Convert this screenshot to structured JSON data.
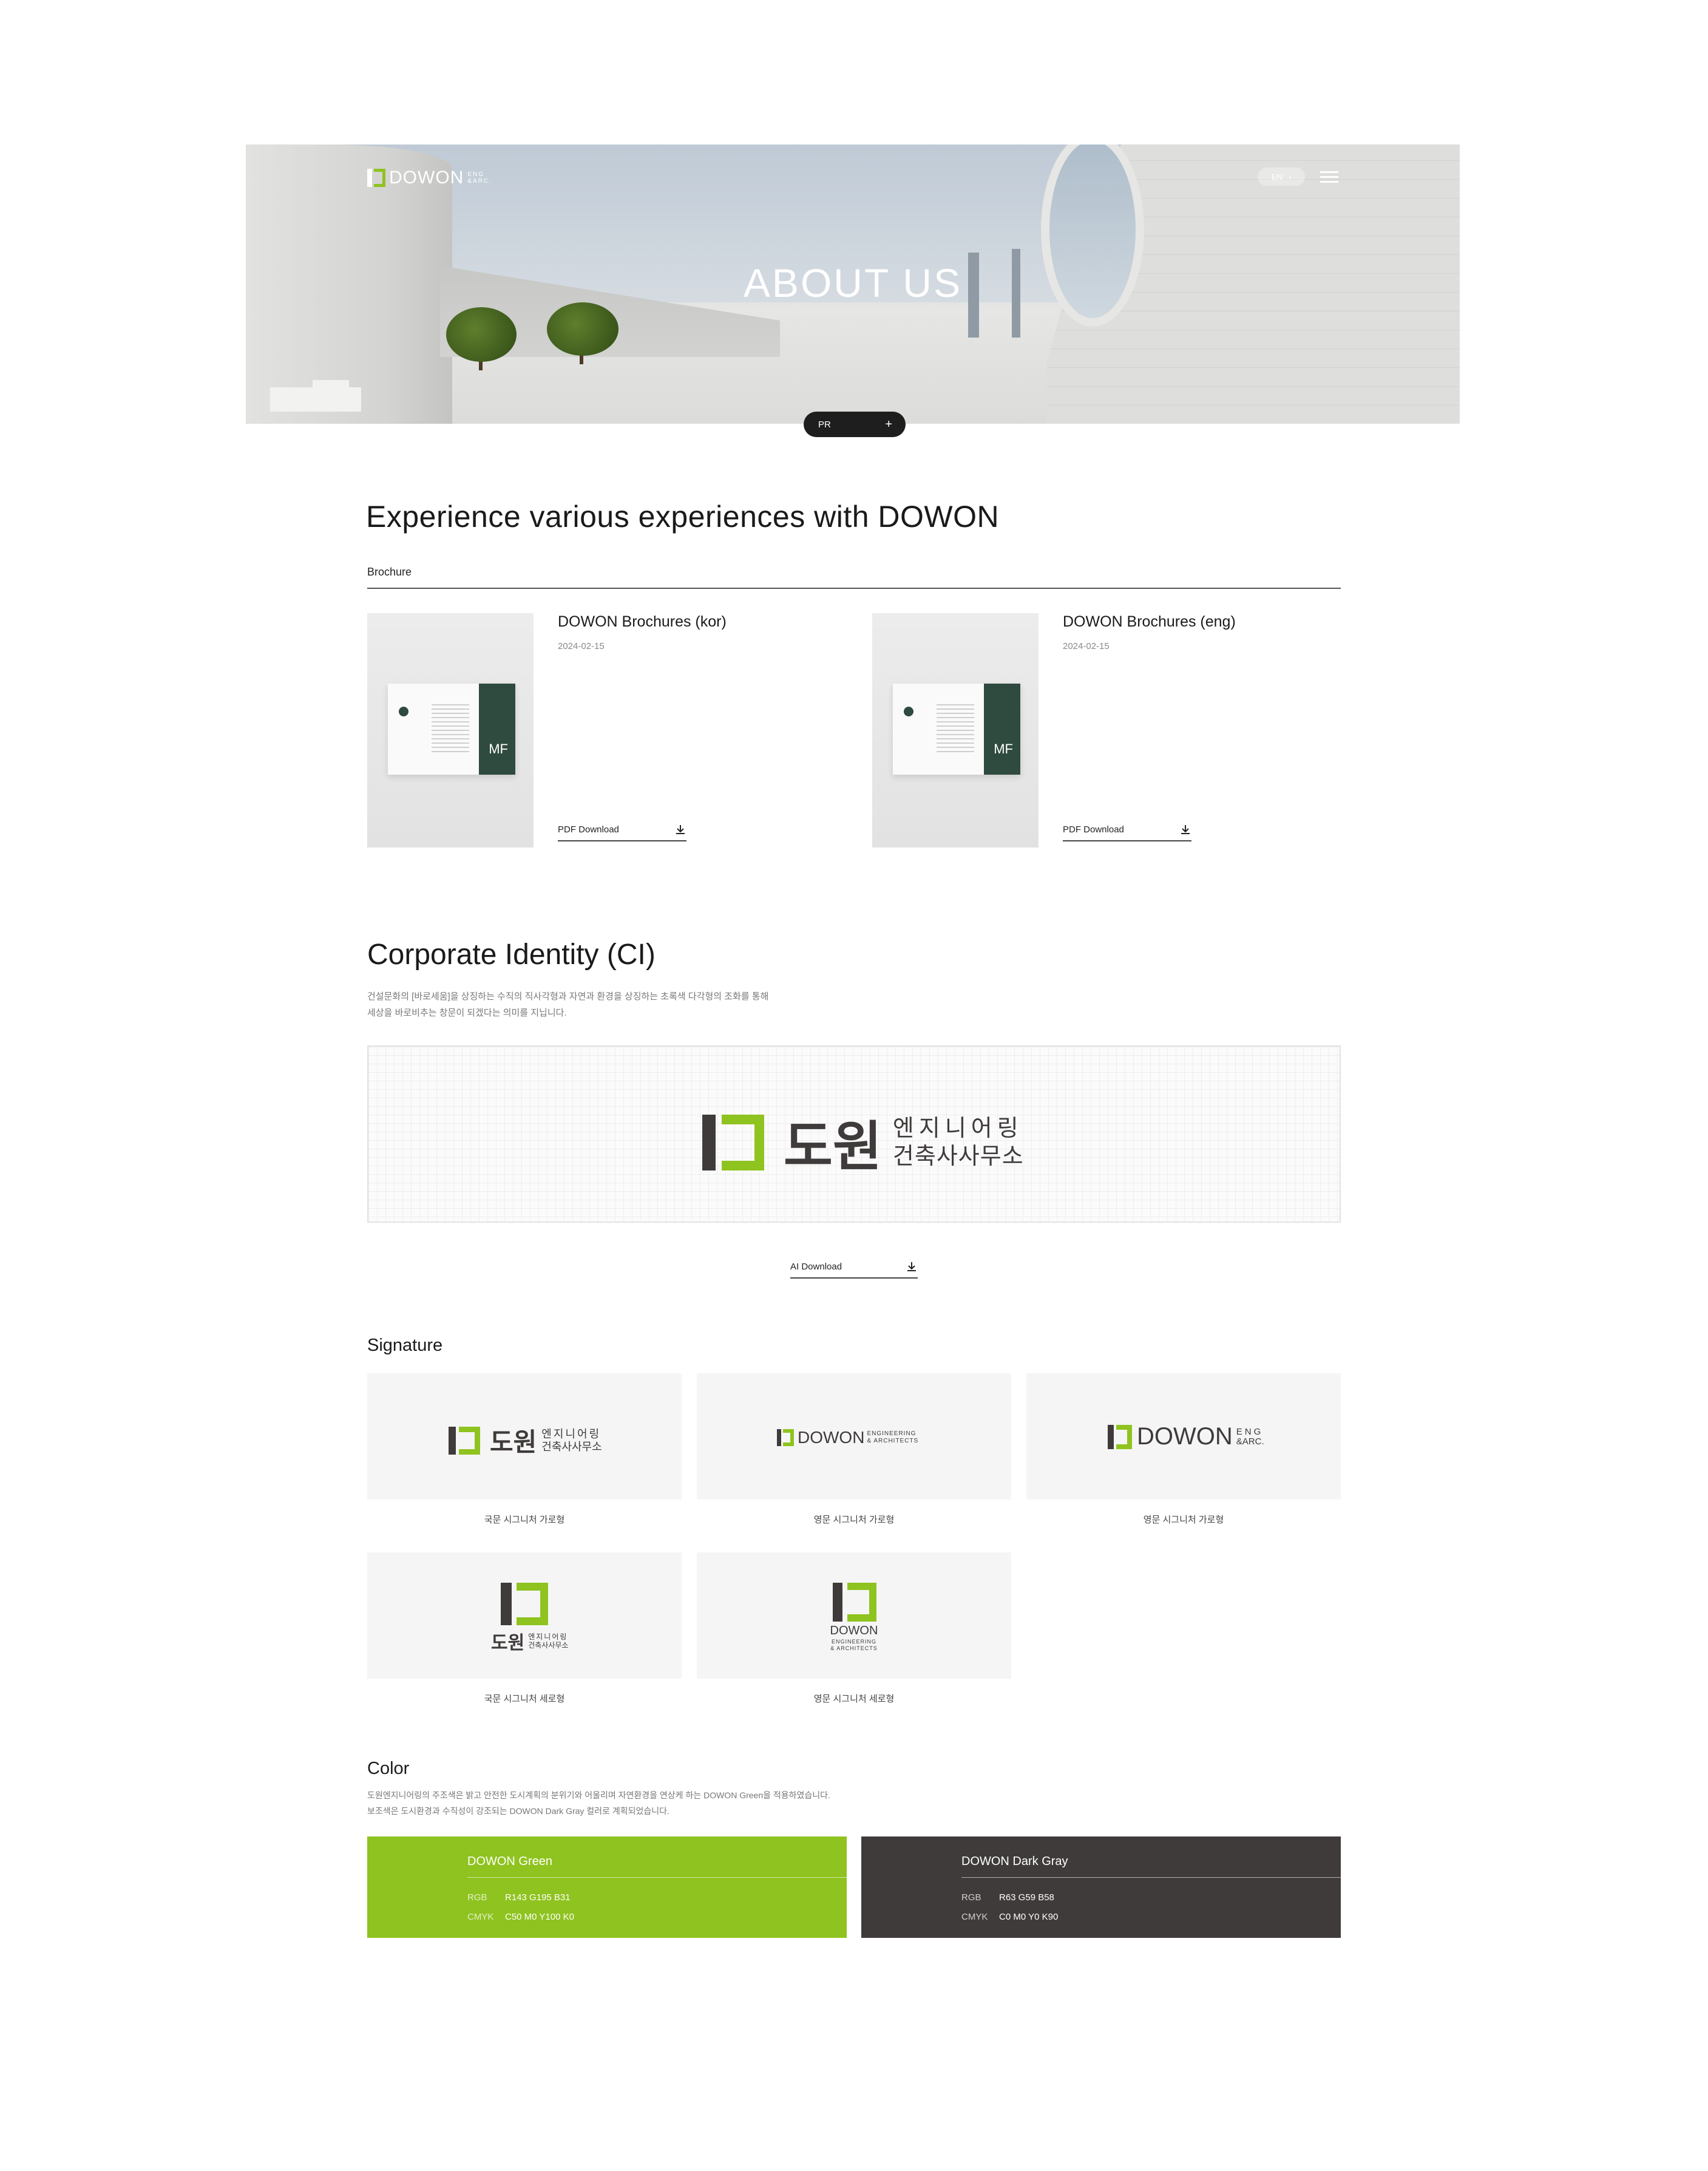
{
  "header": {
    "logo_text": "DOWON",
    "logo_sub_line1": "ENG",
    "logo_sub_line2": "&ARC.",
    "lang_label": "EN",
    "lang_arrow": "›",
    "hero_title": "ABOUT US",
    "pr_label": "PR",
    "pr_plus": "+"
  },
  "brochure": {
    "heading": "Experience various experiences with DOWON",
    "tab": "Brochure",
    "cover_mark": "MF",
    "items": [
      {
        "title": "DOWON Brochures (kor)",
        "date": "2024-02-15",
        "download": "PDF Download"
      },
      {
        "title": "DOWON Brochures (eng)",
        "date": "2024-02-15",
        "download": "PDF Download"
      }
    ]
  },
  "ci": {
    "heading": "Corporate Identity (CI)",
    "desc_line1": "건설문화의 [바로세움]을 상징하는 수직의 직사각형과 자연과 환경을 상징하는 초록색 다각형의 조화를 통해",
    "desc_line2": "세상을 바로비추는 창문이 되겠다는 의미를 지닙니다.",
    "logo_main": "도원",
    "logo_sub_line1": "엔지니어링",
    "logo_sub_line2": "건축사사무소",
    "download": "AI Download"
  },
  "signature": {
    "heading": "Signature",
    "ko_main": "도원",
    "ko_sub_line1": "엔지니어링",
    "ko_sub_line2": "건축사사무소",
    "en_main": "DOWON",
    "en_sub_line1": "ENGINEERING",
    "en_sub_line2": "& ARCHITECTS",
    "eng_sub_line1": "ENG",
    "eng_sub_line2": "&ARC.",
    "captions": [
      "국문 시그니처 가로형",
      "영문 시그니처 가로형",
      "영문 시그니처 가로형",
      "국문 시그니처 세로형",
      "영문 시그니처 세로형"
    ]
  },
  "color": {
    "heading": "Color",
    "desc_line1": "도원엔지니어링의 주조색은 밝고 안전한 도시계획의 분위기와 어울리며 자연환경을 연상케 하는 DOWON Green을 적용하였습니다.",
    "desc_line2": "보조색은 도시환경과 수직성이 강조되는 DOWON Dark Gray 컬러로 계획되었습니다.",
    "swatches": [
      {
        "name": "DOWON Green",
        "hex": "#8fc31f",
        "rgb_label": "RGB",
        "rgb": "R143 G195 B31",
        "cmyk_label": "CMYK",
        "cmyk": "C50 M0 Y100 K0"
      },
      {
        "name": "DOWON Dark Gray",
        "hex": "#3f3b3a",
        "rgb_label": "RGB",
        "rgb": "R63 G59 B58",
        "cmyk_label": "CMYK",
        "cmyk": "C0 M0 Y0 K90"
      }
    ]
  }
}
